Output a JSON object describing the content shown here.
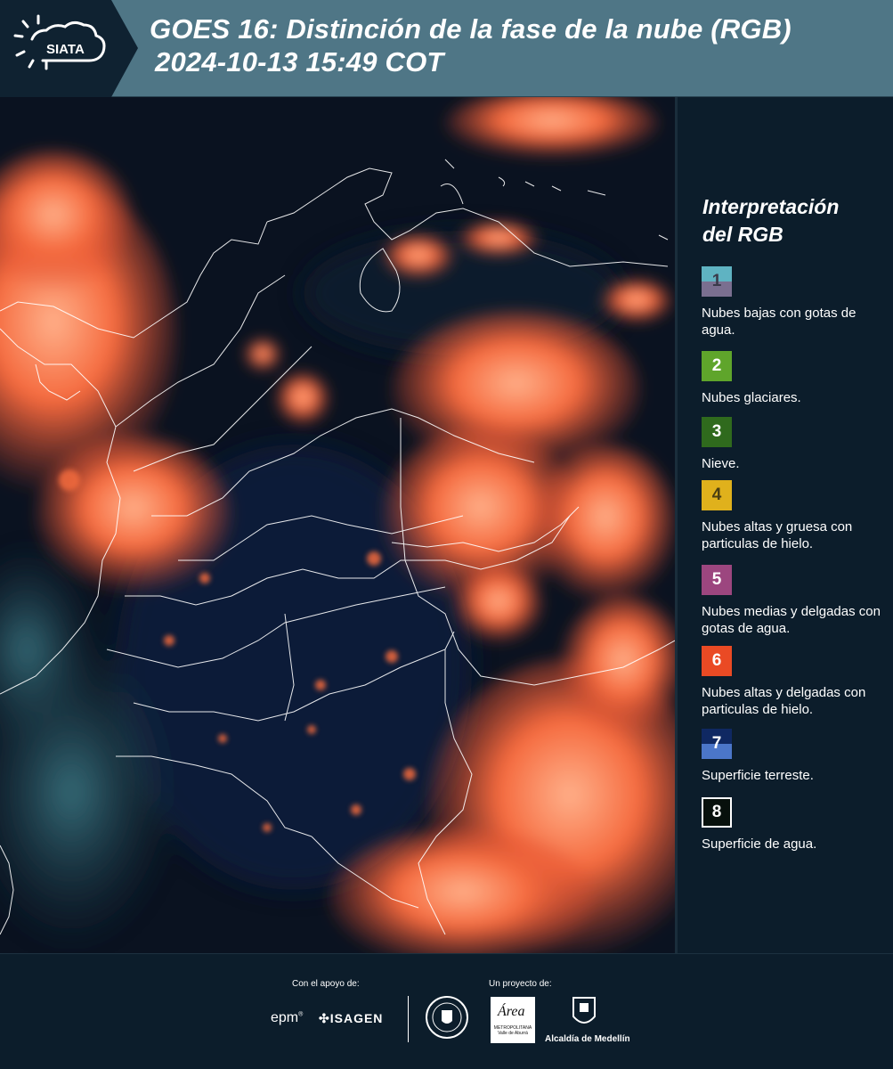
{
  "header": {
    "logo_text": "SIATA",
    "title_line1": "GOES 16: Distinción de la fase de la nube (RGB)",
    "title_line2": "2024-10-13 15:49 COT",
    "background_color": "#4f7686"
  },
  "legend": {
    "title_line1": "Interpretación",
    "title_line2": "del RGB",
    "items": [
      {
        "number": "1",
        "label": "Nubes bajas con gotas de agua.",
        "color_top": "#5fb3c2",
        "color_bottom": "#7a6f90"
      },
      {
        "number": "2",
        "label": "Nubes glaciares.",
        "color_top": "#5fa52b",
        "color_bottom": "#5fa52b"
      },
      {
        "number": "3",
        "label": "Nieve.",
        "color_top": "#2f6a1d",
        "color_bottom": "#2f6a1d"
      },
      {
        "number": "4",
        "label": "Nubes altas y gruesa con particulas de hielo.",
        "color_top": "#e0b11c",
        "color_bottom": "#e0b11c"
      },
      {
        "number": "5",
        "label": "Nubes medias y delgadas con gotas de agua.",
        "color_top": "#9c467f",
        "color_bottom": "#9c467f"
      },
      {
        "number": "6",
        "label": "Nubes altas y delgadas con particulas de hielo.",
        "color_top": "#ea4a24",
        "color_bottom": "#ea4a24"
      },
      {
        "number": "7",
        "label": "Superficie terreste.",
        "color_top": "#0f2862",
        "color_bottom": "#4b76c9"
      },
      {
        "number": "8",
        "label": "Superficie de agua.",
        "color_top": "#07100c",
        "color_bottom": "#07100c"
      }
    ]
  },
  "footer": {
    "support_label": "Con el apoyo de:",
    "project_label": "Un proyecto de:",
    "sponsors": [
      "epm",
      "ISAGEN"
    ],
    "partners": [
      "Área METROPOLITANA Valle de Aburrá",
      "Alcaldía de Medellín"
    ],
    "area_title": "Área",
    "area_sub1": "METROPOLITANA",
    "area_sub2": "Valle de Aburrá",
    "alcaldia_label": "Alcaldía de Medellín",
    "epm_label": "epm",
    "isagen_label": "ISAGEN"
  },
  "colors": {
    "panel_background": "#0c1d2b",
    "cloud_orange": "#f2603a",
    "surface_dark": "#0a1423"
  }
}
